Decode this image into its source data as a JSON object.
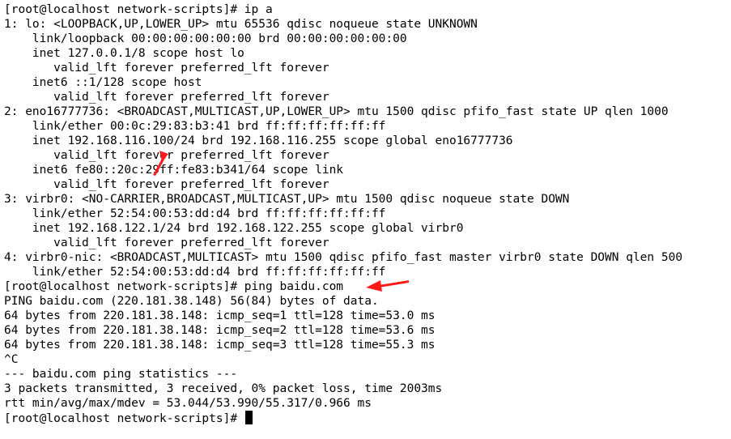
{
  "terminal": {
    "lines": [
      "[root@localhost network-scripts]# ip a",
      "1: lo: <LOOPBACK,UP,LOWER_UP> mtu 65536 qdisc noqueue state UNKNOWN",
      "    link/loopback 00:00:00:00:00:00 brd 00:00:00:00:00:00",
      "    inet 127.0.0.1/8 scope host lo",
      "       valid_lft forever preferred_lft forever",
      "    inet6 ::1/128 scope host",
      "       valid_lft forever preferred_lft forever",
      "2: eno16777736: <BROADCAST,MULTICAST,UP,LOWER_UP> mtu 1500 qdisc pfifo_fast state UP qlen 1000",
      "    link/ether 00:0c:29:83:b3:41 brd ff:ff:ff:ff:ff:ff",
      "    inet 192.168.116.100/24 brd 192.168.116.255 scope global eno16777736",
      "       valid_lft forever preferred_lft forever",
      "    inet6 fe80::20c:29ff:fe83:b341/64 scope link",
      "       valid_lft forever preferred_lft forever",
      "3: virbr0: <NO-CARRIER,BROADCAST,MULTICAST,UP> mtu 1500 qdisc noqueue state DOWN",
      "    link/ether 52:54:00:53:dd:d4 brd ff:ff:ff:ff:ff:ff",
      "    inet 192.168.122.1/24 brd 192.168.122.255 scope global virbr0",
      "       valid_lft forever preferred_lft forever",
      "4: virbr0-nic: <BROADCAST,MULTICAST> mtu 1500 qdisc pfifo_fast master virbr0 state DOWN qlen 500",
      "    link/ether 52:54:00:53:dd:d4 brd ff:ff:ff:ff:ff:ff",
      "[root@localhost network-scripts]# ping baidu.com",
      "PING baidu.com (220.181.38.148) 56(84) bytes of data.",
      "64 bytes from 220.181.38.148: icmp_seq=1 ttl=128 time=53.0 ms",
      "64 bytes from 220.181.38.148: icmp_seq=2 ttl=128 time=53.6 ms",
      "64 bytes from 220.181.38.148: icmp_seq=3 ttl=128 time=55.3 ms",
      "^C",
      "--- baidu.com ping statistics ---",
      "3 packets transmitted, 3 received, 0% packet loss, time 2003ms",
      "rtt min/avg/max/mdev = 53.044/53.990/55.317/0.966 ms"
    ],
    "prompt": "[root@localhost network-scripts]# "
  },
  "colors": {
    "background": "#ffffff",
    "text": "#000000",
    "annotation_arrow": "#ff1a1a"
  },
  "icons": [
    "annotation-arrow-icon",
    "cursor-block"
  ]
}
